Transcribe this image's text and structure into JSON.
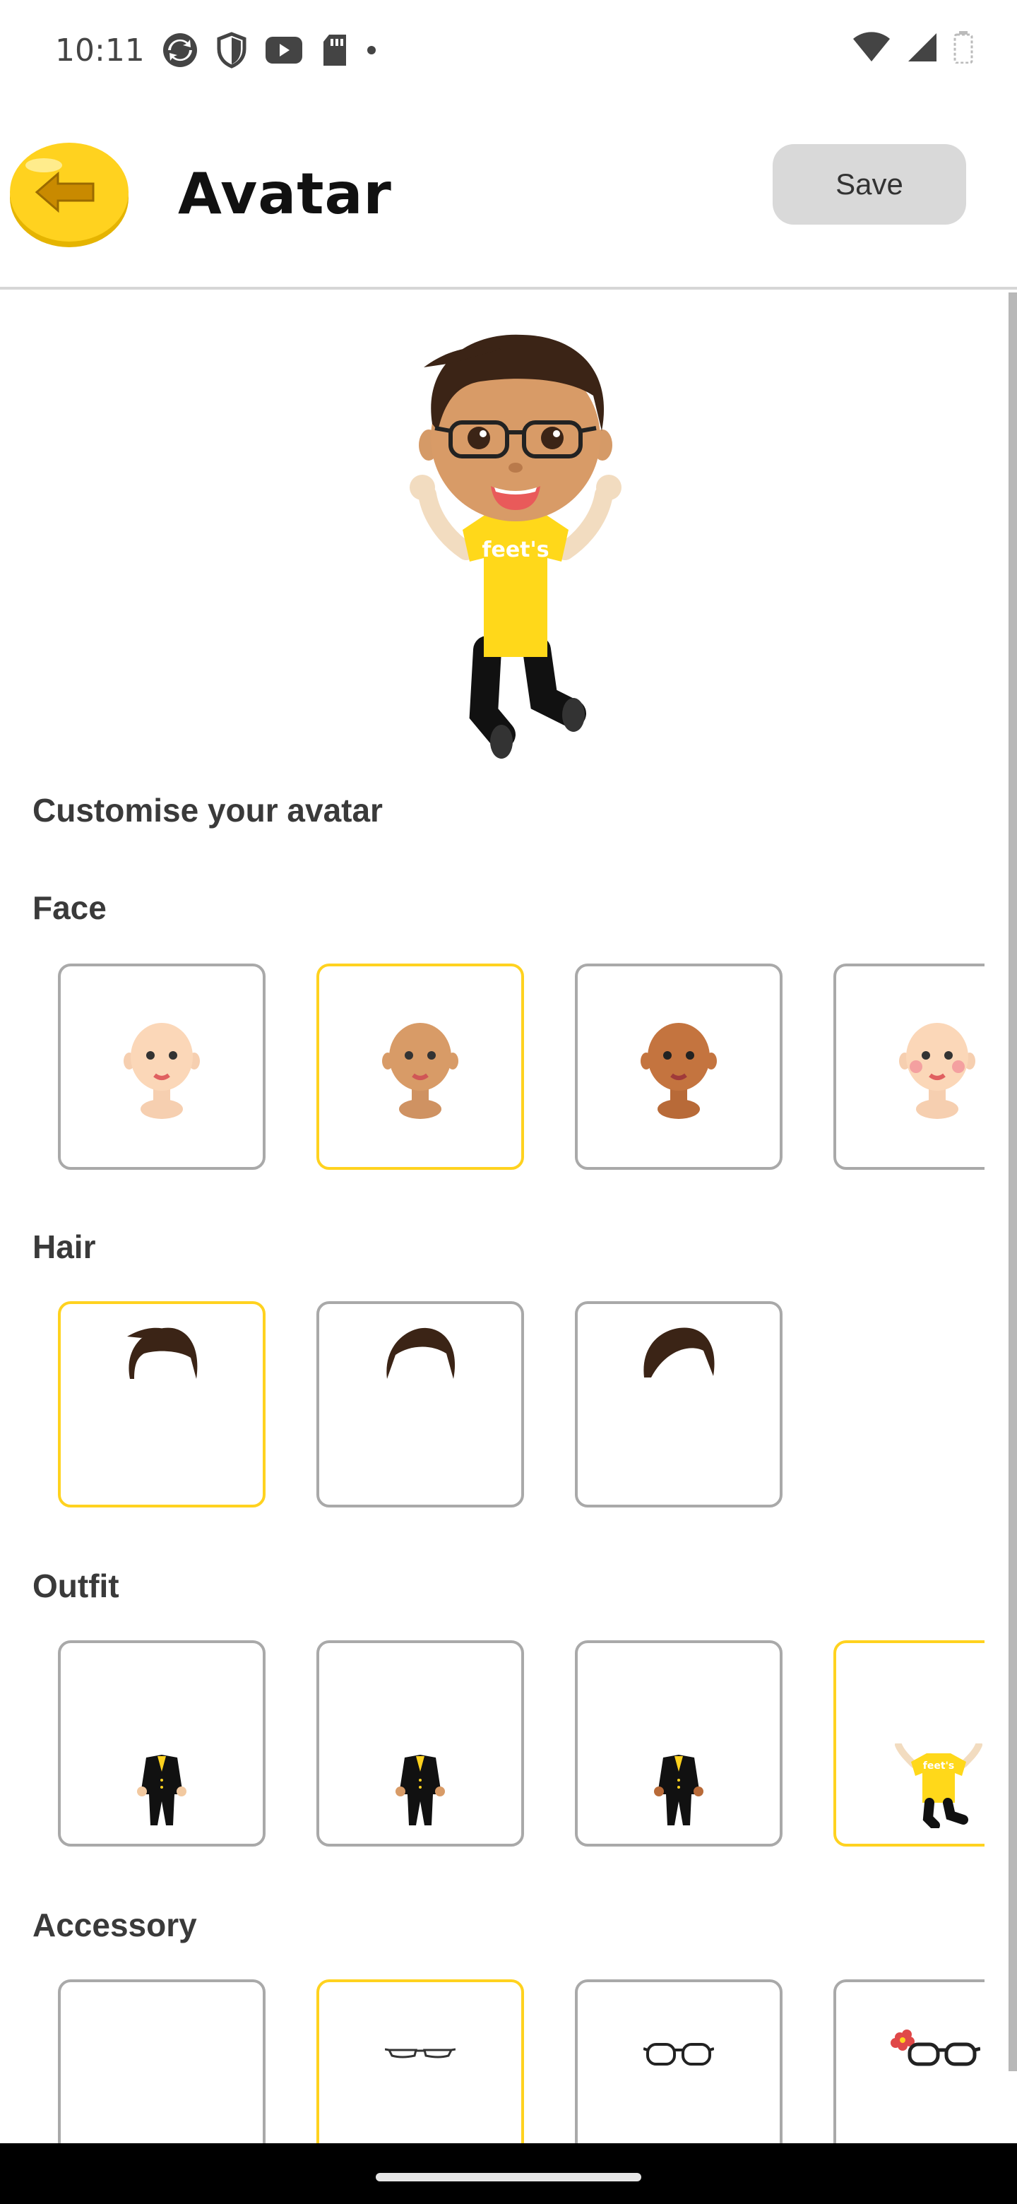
{
  "status_bar": {
    "time": "10:11",
    "left_icons": [
      "sync-icon",
      "shield-icon",
      "youtube-icon",
      "sd-card-icon",
      "dot-icon"
    ],
    "right_icons": [
      "wifi-icon",
      "signal-icon",
      "battery-icon"
    ]
  },
  "header": {
    "title": "Avatar",
    "save_label": "Save",
    "back_icon": "back-arrow-icon"
  },
  "hero": {
    "shirt_text": "feet's"
  },
  "customise_heading": "Customise your avatar",
  "sections": {
    "face": {
      "heading": "Face",
      "selected_index": 1,
      "options": [
        "light",
        "tan",
        "brown",
        "light-blush"
      ]
    },
    "hair": {
      "heading": "Hair",
      "selected_index": 0,
      "options": [
        "quiff",
        "side-part",
        "swept"
      ]
    },
    "outfit": {
      "heading": "Outfit",
      "selected_index": 3,
      "options": [
        "black-suit",
        "black-suit",
        "black-suit",
        "yellow-tshirt"
      ],
      "tshirt_text": "feet's"
    },
    "accessory": {
      "heading": "Accessory",
      "selected_index": 1,
      "options": [
        "none",
        "thin-glasses",
        "round-glasses",
        "flower-glasses"
      ]
    }
  },
  "colors": {
    "brand_yellow": "#ffd21f",
    "selected_border": "#ffd21f",
    "unselected_border": "#a9a9a9",
    "save_bg": "#d9d9d9"
  }
}
